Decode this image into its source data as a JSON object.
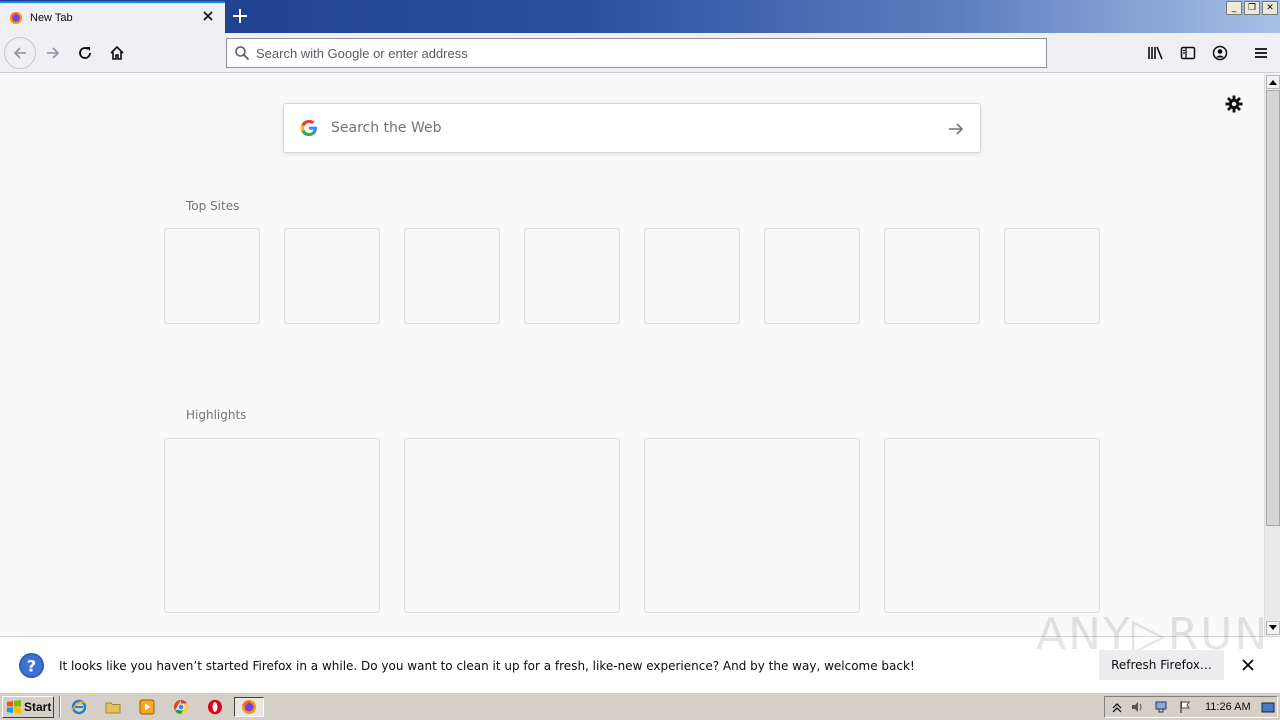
{
  "browser": {
    "tab_title": "New Tab",
    "url_placeholder": "Search with Google or enter address",
    "window_controls": [
      "_",
      "❐",
      "✕"
    ]
  },
  "newtab": {
    "search_placeholder": "Search the Web",
    "top_sites_title": "Top Sites",
    "highlights_title": "Highlights",
    "top_sites_count": 8,
    "highlights_count": 4
  },
  "notification": {
    "message": "It looks like you haven’t started Firefox in a while. Do you want to clean it up for a fresh, like-new experience? And by the way, welcome back!",
    "button_label": "Refresh Firefox…"
  },
  "watermark": "ANY▷RUN",
  "taskbar": {
    "start_label": "Start",
    "clock": "11:26 AM"
  },
  "colors": {
    "accent": "#0a84ff",
    "titlebar_start": "#1c3a8a",
    "titlebar_end": "#a9c0e6"
  }
}
